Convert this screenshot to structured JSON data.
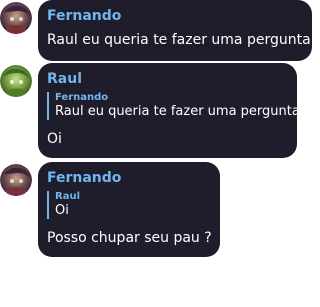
{
  "messages": [
    {
      "sender": "Fernando",
      "text": "Raul eu queria te fazer uma pergunta",
      "avatar_icon": "user-avatar-fernando"
    },
    {
      "sender": "Raul",
      "reply": {
        "sender": "Fernando",
        "text": "Raul eu queria te fazer uma pergunta"
      },
      "text": "Oi",
      "avatar_icon": "user-avatar-raul"
    },
    {
      "sender": "Fernando",
      "reply": {
        "sender": "Raul",
        "text": "Oi"
      },
      "text": "Posso chupar seu pau ?",
      "avatar_icon": "user-avatar-fernando"
    }
  ],
  "colors": {
    "bubble": "#1f1d2b",
    "sender_name": "#6fb6ee",
    "text": "#ffffff",
    "background": "#ffffff"
  }
}
